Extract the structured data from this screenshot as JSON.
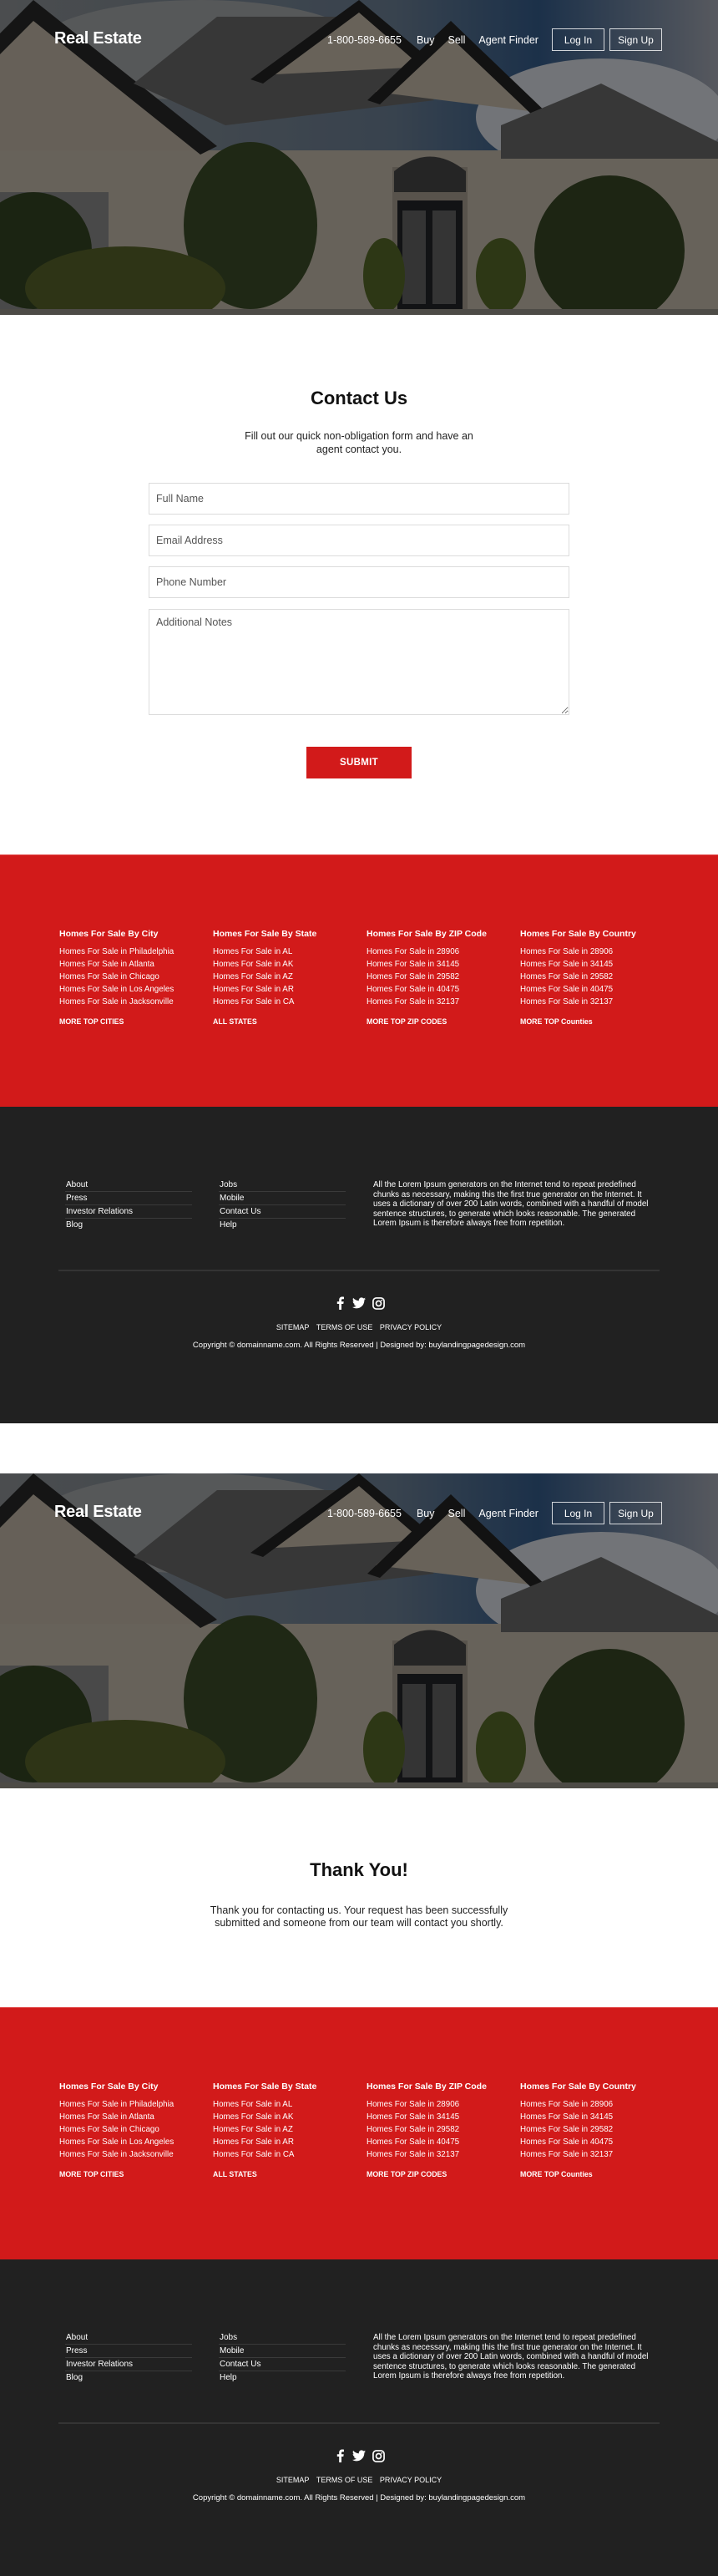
{
  "header": {
    "logo": "Real Estate",
    "phone": "1-800-589-6655",
    "nav": [
      "Buy",
      "Sell",
      "Agent Finder"
    ],
    "login_label": "Log In",
    "signup_label": "Sign Up"
  },
  "contact": {
    "title": "Contact Us",
    "subtitle": "Fill out our quick non-obligation form and have an agent contact you.",
    "fields": {
      "full_name": {
        "placeholder": "Full Name",
        "value": ""
      },
      "email": {
        "placeholder": "Email Address",
        "value": ""
      },
      "phone": {
        "placeholder": "Phone Number",
        "value": ""
      },
      "notes": {
        "placeholder": "Additional Notes",
        "value": ""
      }
    },
    "submit_label": "SUBMIT"
  },
  "thank_you": {
    "title": "Thank You!",
    "message": "Thank you for contacting us. Your request has been successfully submitted and someone from our team will contact you shortly."
  },
  "listings": {
    "columns": [
      {
        "heading": "Homes For Sale By City",
        "items": [
          "Homes For Sale in Philadelphia",
          "Homes For Sale in Atlanta",
          "Homes For Sale in Chicago",
          "Homes For Sale in Los Angeles",
          "Homes For Sale in Jacksonville"
        ],
        "more": "MORE TOP CITIES"
      },
      {
        "heading": "Homes For Sale By State",
        "items": [
          "Homes For Sale in AL",
          "Homes For Sale in AK",
          "Homes For Sale in AZ",
          "Homes For Sale in AR",
          "Homes For Sale in CA"
        ],
        "more": "ALL STATES"
      },
      {
        "heading": "Homes For Sale By ZIP Code",
        "items": [
          "Homes For Sale in 28906",
          "Homes For Sale in 34145",
          "Homes For Sale in 29582",
          "Homes For Sale in 40475",
          "Homes For Sale in 32137"
        ],
        "more": "MORE TOP ZIP CODES"
      },
      {
        "heading": "Homes For Sale By Country",
        "items": [
          "Homes For Sale in 28906",
          "Homes For Sale in 34145",
          "Homes For Sale in 29582",
          "Homes For Sale in 40475",
          "Homes For Sale in 32137"
        ],
        "more": "MORE TOP Counties"
      }
    ]
  },
  "footer": {
    "links_left": [
      "About",
      "Press",
      "Investor Relations",
      "Blog"
    ],
    "links_right": [
      "Jobs",
      "Mobile",
      "Contact Us",
      "Help"
    ],
    "about_text": "All the Lorem Ipsum generators on the Internet tend to repeat predefined chunks as necessary, making this the first true generator on the Internet. It uses a dictionary of over 200 Latin words, combined with a handful of model sentence structures, to generate which looks reasonable. The generated Lorem Ipsum is therefore always free from repetition.",
    "social": [
      "facebook-icon",
      "twitter-icon",
      "instagram-icon"
    ],
    "legal": [
      "SITEMAP",
      "TERMS OF USE",
      "PRIVACY POLICY"
    ],
    "copyright": "Copyright © domainname.com. All Rights Reserved | Designed by: buylandingpagedesign.com"
  },
  "colors": {
    "accent": "#d21a1a",
    "footer_dark": "#212121",
    "text_dark": "#111111"
  }
}
